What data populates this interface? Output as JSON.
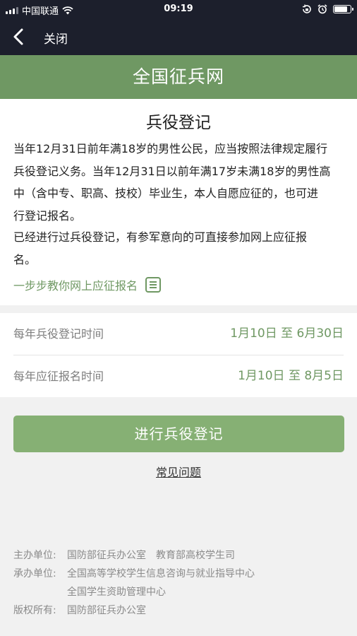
{
  "status_bar": {
    "carrier": "中国联通",
    "time": "09:19",
    "battery_level": 0.85
  },
  "nav": {
    "close_label": "关闭"
  },
  "banner": {
    "title": "全国征兵网"
  },
  "intro": {
    "title": "兵役登记",
    "paragraph1_lines": [
      "当年12月31日前年满18岁的男性公民，应当按照法律规定履行",
      "兵役登记义务。当年12月31日以前年满17岁未满18岁的男性高",
      "中（含中专、职高、技校）毕业生，本人自愿应征的，也可进",
      "行登记报名。"
    ],
    "paragraph2_lines": [
      "已经进行过兵役登记，有参军意向的可直接参加网上应征报",
      "名。"
    ],
    "guide_link": "一步步教你网上应征报名"
  },
  "times": [
    {
      "label": "每年兵役登记时间",
      "value": "1月10日 至 6月30日"
    },
    {
      "label": "每年应征报名时间",
      "value": "1月10日 至 8月5日"
    }
  ],
  "actions": {
    "register_button": "进行兵役登记",
    "faq_link": "常见问题"
  },
  "footer": {
    "organizer_label": "主办单位:",
    "organizer_value": "国防部征兵办公室　教育部高校学生司",
    "undertaker_label": "承办单位:",
    "undertaker_value1": "全国高等学校学生信息咨询与就业指导中心",
    "undertaker_value2": "全国学生资助管理中心",
    "copyright_label": "版权所有:",
    "copyright_value": "国防部征兵办公室"
  },
  "colors": {
    "dark_header": "#1c1f2c",
    "brand_green": "#6f9863",
    "button_green": "#86b074"
  },
  "icons": [
    "signal-icon",
    "wifi-icon",
    "lock-rotation-icon",
    "alarm-icon",
    "battery-icon",
    "back-arrow-icon",
    "document-list-icon"
  ]
}
